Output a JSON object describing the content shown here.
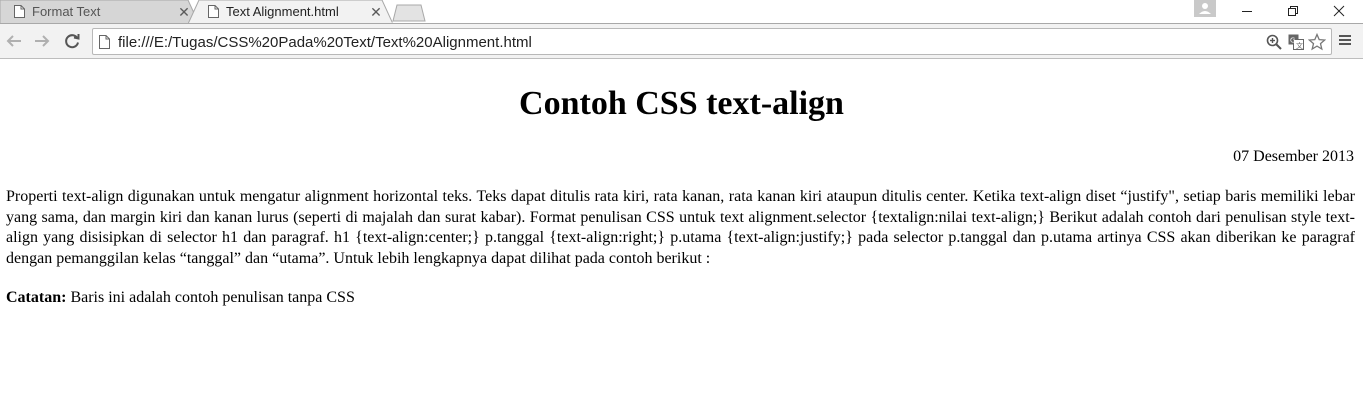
{
  "browser": {
    "tabs": [
      {
        "title": "Format Text",
        "active": false
      },
      {
        "title": "Text Alignment.html",
        "active": true
      }
    ],
    "address_bar": {
      "url": "file:///E:/Tugas/CSS%20Pada%20Text/Text%20Alignment.html"
    },
    "icons": {
      "back": "arrow-left-icon",
      "forward": "arrow-right-icon",
      "reload": "reload-icon",
      "zoom": "zoom-icon",
      "translate": "translate-icon",
      "bookmark": "star-icon",
      "menu": "hamburger-menu-icon"
    },
    "colors": {
      "toolbar": "#f2f2f2",
      "tab_active": "#f2f2f2",
      "tab_inactive": "#d6d6d6"
    }
  },
  "page": {
    "title": "Contoh CSS text-align",
    "date": "07 Desember 2013",
    "paragraph": "Properti text-align digunakan untuk mengatur alignment horizontal teks. Teks dapat ditulis rata kiri, rata kanan, rata kanan kiri ataupun ditulis center. Ketika text-align diset “justify\", setiap baris memiliki lebar yang sama, dan margin kiri dan kanan lurus (seperti di majalah dan surat kabar). Format penulisan CSS untuk text alignment.selector {textalign:nilai text-align;} Berikut adalah contoh dari penulisan style text-align yang disisipkan di selector h1 dan paragraf. h1 {text-align:center;} p.tanggal {text-align:right;} p.utama {text-align:justify;} pada selector p.tanggal dan p.utama artinya CSS akan diberikan ke paragraf dengan pemanggilan kelas “tanggal” dan “utama”. Untuk lebih lengkapnya dapat dilihat pada contoh berikut :",
    "note_label": "Catatan:",
    "note_text": " Baris ini adalah contoh penulisan tanpa CSS"
  }
}
